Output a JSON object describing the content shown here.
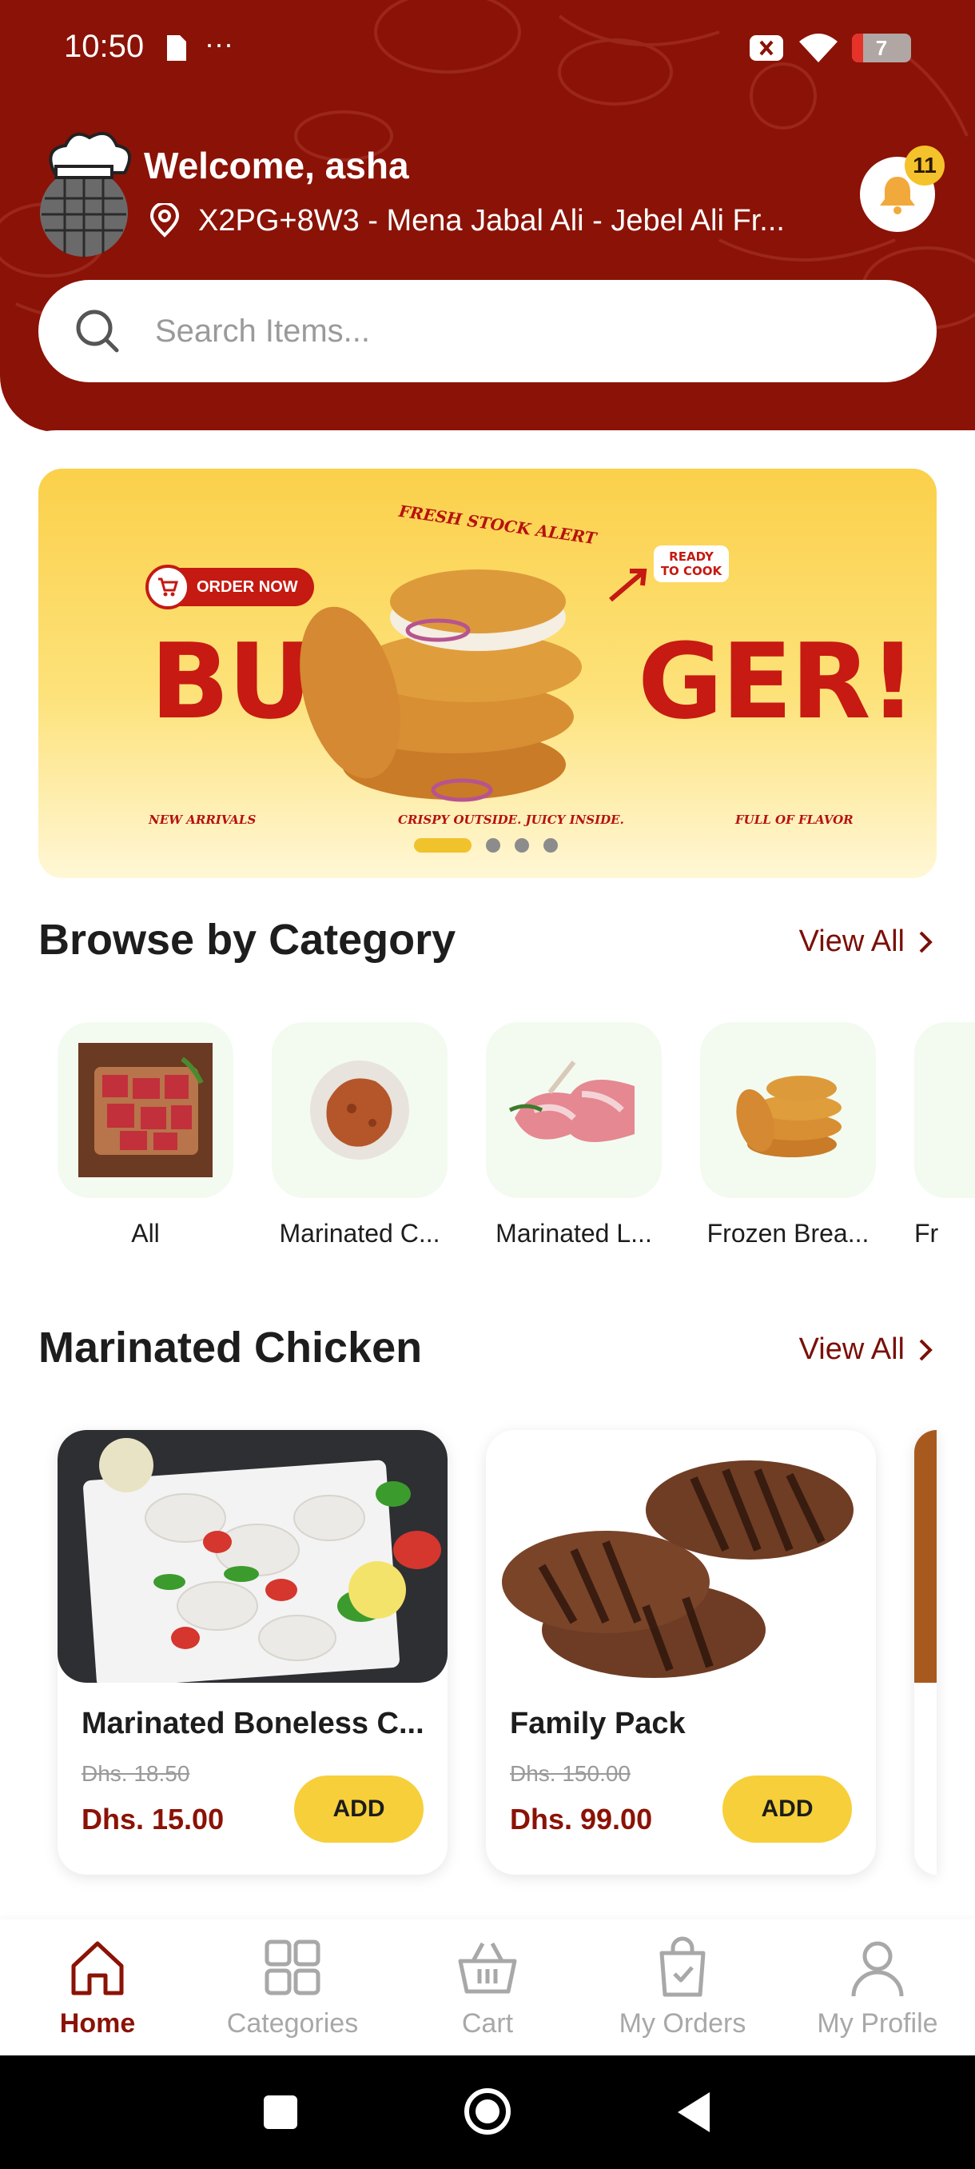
{
  "status_bar": {
    "time": "10:50",
    "more": "···",
    "battery_level": "7"
  },
  "header": {
    "welcome": "Welcome, asha",
    "location": "X2PG+8W3 - Mena Jabal Ali - Jebel Ali Fr...",
    "notification_count": "11"
  },
  "search": {
    "placeholder": "Search Items..."
  },
  "banner": {
    "cta": "ORDER NOW",
    "headline_left": "BU",
    "headline_right": "GER!",
    "tag_top": "FRESH STOCK ALERT",
    "ready_line1": "READY",
    "ready_line2": "TO COOK",
    "footer_left": "NEW ARRIVALS",
    "footer_center": "CRISPY OUTSIDE. JUICY INSIDE.",
    "footer_right": "FULL OF FLAVOR",
    "active_slide": 1,
    "slide_count": 4
  },
  "categories_section": {
    "title": "Browse by Category",
    "view_all": "View All",
    "items": [
      {
        "label": "All"
      },
      {
        "label": "Marinated C..."
      },
      {
        "label": "Marinated L..."
      },
      {
        "label": "Frozen Brea..."
      },
      {
        "label": "Fr"
      }
    ]
  },
  "products_section": {
    "title": "Marinated Chicken",
    "view_all": "View All",
    "items": [
      {
        "name": "Marinated Boneless C...",
        "old_price": "Dhs. 18.50",
        "price": "Dhs. 15.00",
        "add": "ADD"
      },
      {
        "name": "Family Pack",
        "old_price": "Dhs. 150.00",
        "price": "Dhs. 99.00",
        "add": "ADD"
      }
    ]
  },
  "bottom_nav": {
    "items": [
      {
        "label": "Home",
        "active": true
      },
      {
        "label": "Categories"
      },
      {
        "label": "Cart"
      },
      {
        "label": "My Orders"
      },
      {
        "label": "My Profile"
      }
    ]
  },
  "colors": {
    "brand": "#8b1206",
    "accent": "#f7cf3a",
    "muted": "#a8a8a8"
  }
}
